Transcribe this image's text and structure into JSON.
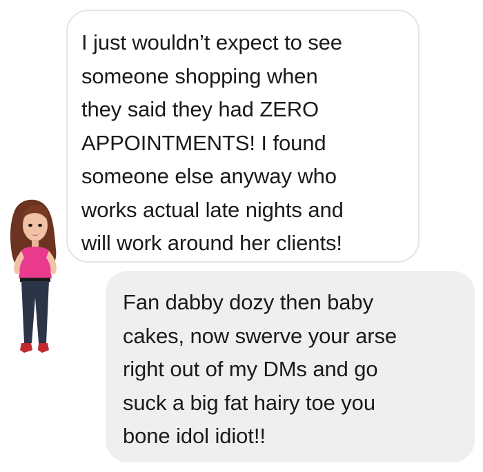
{
  "conversation": {
    "messages": [
      {
        "sender": "other",
        "text": "I just wouldn’t expect to see\nsomeone shopping when\nthey said they had ZERO\nAPPOINTMENTS! I found\nsomeone else anyway who\nworks actual late nights and\nwill work around her clients!"
      },
      {
        "sender": "me",
        "text": "Fan dabby dozy then baby\ncakes, now swerve your arse\nright out of my DMs and go\nsuck a big fat hairy toe you\nbone idol idiot!!"
      }
    ]
  },
  "colors": {
    "received_bubble_bg": "#ffffff",
    "received_bubble_border": "#e3e3e3",
    "sent_bubble_bg": "#efefef",
    "text": "#1a1a1a"
  },
  "icons": {
    "avatar": "bitmoji-avatar-icon"
  }
}
